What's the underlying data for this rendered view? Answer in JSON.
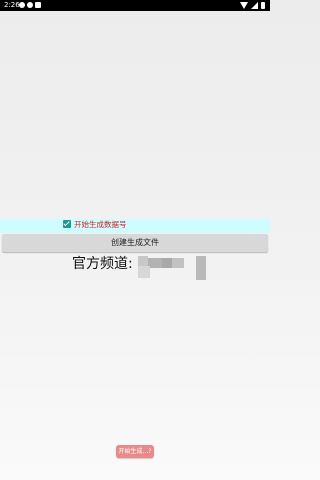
{
  "status_bar": {
    "time": "2:26"
  },
  "options": {
    "generate_checkbox_label": "开始生成数据号",
    "generate_checked": true
  },
  "create_button": {
    "label": "创建生成文件"
  },
  "channel": {
    "label": "官方频道:"
  },
  "bottom_button": {
    "label": "开始生成...?"
  },
  "colors": {
    "strip_background": "#cffcfc",
    "checkbox_label": "#d0202a",
    "button_background": "#d8d8d8",
    "bottom_button": "#e88a8a"
  }
}
